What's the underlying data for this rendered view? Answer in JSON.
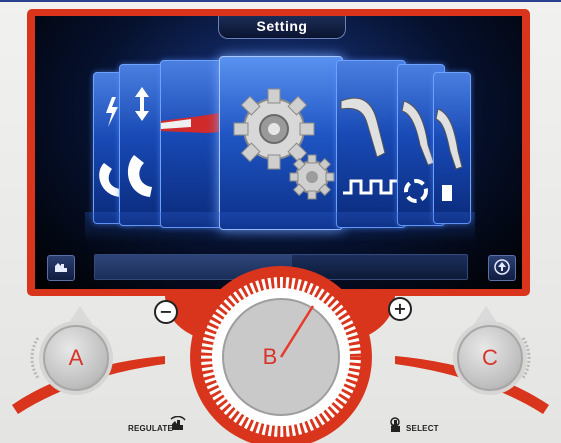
{
  "screen": {
    "title": "Setting",
    "progress": 0.53
  },
  "knobs": {
    "left": {
      "label": "A"
    },
    "center": {
      "label": "B"
    },
    "right": {
      "label": "C"
    }
  },
  "signs": {
    "minus": "−",
    "plus": "+"
  },
  "bottom_labels": {
    "regulate": "REGULATE",
    "select": "SELECT"
  },
  "icons": {
    "left_corner": "hand-settings-icon",
    "right_corner": "upload-icon",
    "center_card": "gears-icon"
  },
  "colors": {
    "frame_red": "#d9341c",
    "screen_blue": "#1849b4",
    "knob_letter": "#d8342a"
  }
}
